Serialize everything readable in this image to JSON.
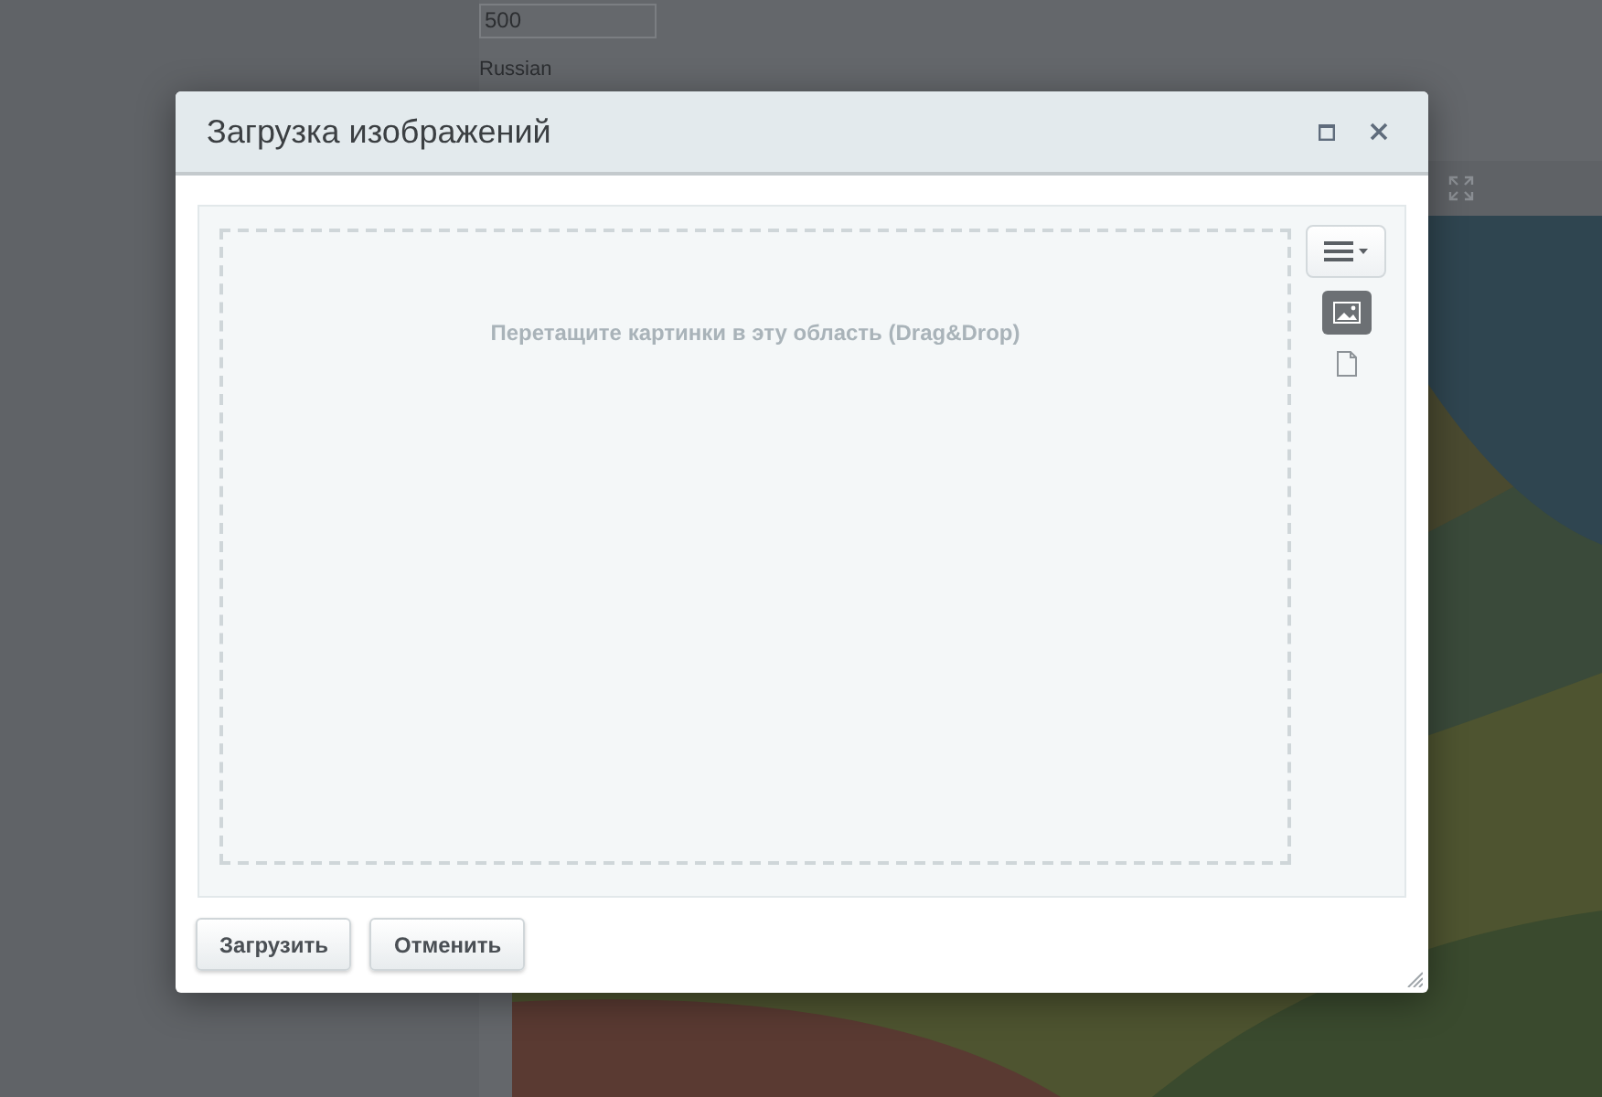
{
  "background_page": {
    "number_field": {
      "value": "500"
    },
    "language_label": "Russian"
  },
  "dialog": {
    "title": "Загрузка изображений",
    "dropzone": {
      "hint": "Перетащите картинки в эту область (Drag&Drop)"
    },
    "view_modes": [
      {
        "kind": "images",
        "selected": true
      },
      {
        "kind": "files",
        "selected": false
      }
    ],
    "buttons": [
      {
        "label": "Загрузить"
      },
      {
        "label": "Отменить"
      }
    ]
  }
}
